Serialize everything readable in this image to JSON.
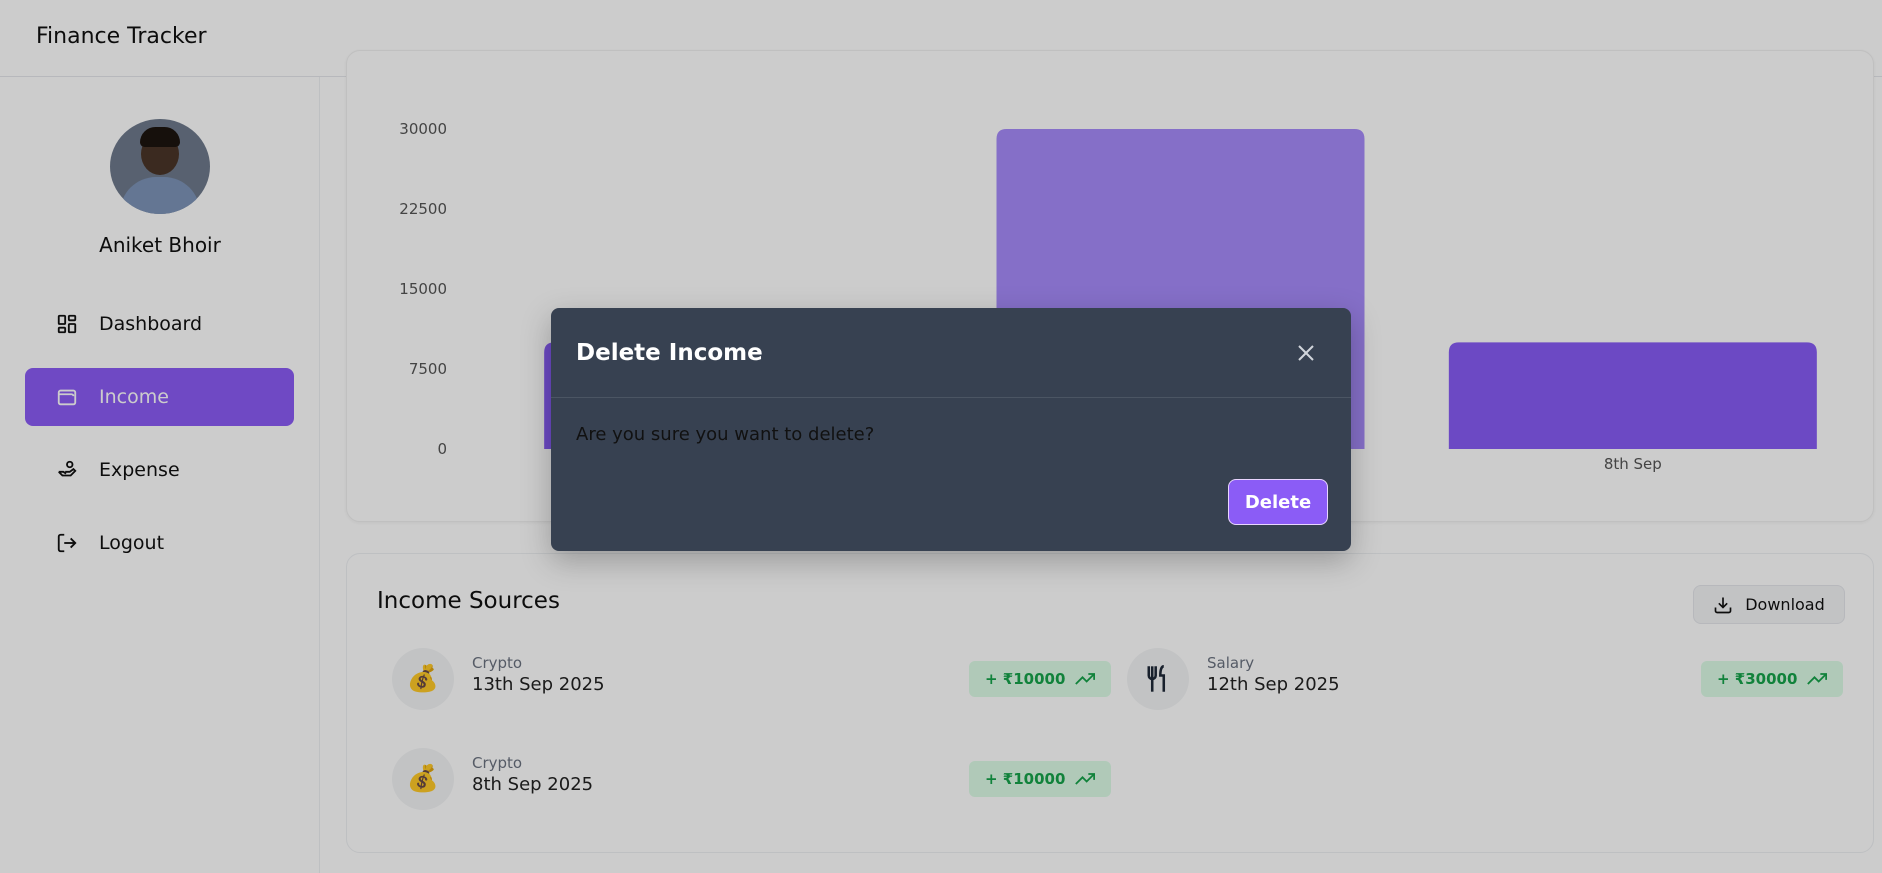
{
  "header": {
    "title": "Finance Tracker"
  },
  "sidebar": {
    "user_name": "Aniket Bhoir",
    "items": [
      {
        "label": "Dashboard",
        "icon": "dashboard-icon",
        "active": false
      },
      {
        "label": "Income",
        "icon": "wallet-icon",
        "active": true
      },
      {
        "label": "Expense",
        "icon": "hand-coins-icon",
        "active": false
      },
      {
        "label": "Logout",
        "icon": "logout-icon",
        "active": false
      }
    ]
  },
  "chart_data": {
    "type": "bar",
    "categories": [
      "",
      "",
      "8th Sep"
    ],
    "values": [
      10000,
      30000,
      10000
    ],
    "bar_colors": [
      "#875cf5",
      "#a78bfa",
      "#875cf5"
    ],
    "ylim": [
      0,
      30000
    ],
    "yticks": [
      "30000",
      "22500",
      "15000",
      "7500",
      "0"
    ],
    "grid": false
  },
  "sources": {
    "title": "Income Sources",
    "download_label": "Download",
    "items": [
      {
        "category": "Crypto",
        "date": "13th Sep 2025",
        "amount": "+ ₹10000",
        "icon": "money-bag-icon",
        "glyph": "💰"
      },
      {
        "category": "Salary",
        "date": "12th Sep 2025",
        "amount": "+ ₹30000",
        "icon": "utensils-icon",
        "glyph": ""
      },
      {
        "category": "Crypto",
        "date": "8th Sep 2025",
        "amount": "+ ₹10000",
        "icon": "money-bag-icon",
        "glyph": "💰"
      }
    ]
  },
  "modal": {
    "title": "Delete Income",
    "message": "Are you sure you want to delete?",
    "delete_label": "Delete"
  },
  "colors": {
    "accent": "#8b5cf6",
    "income_green": "#16a34a",
    "income_green_bg": "#dcfce7",
    "modal_bg": "#374151"
  }
}
